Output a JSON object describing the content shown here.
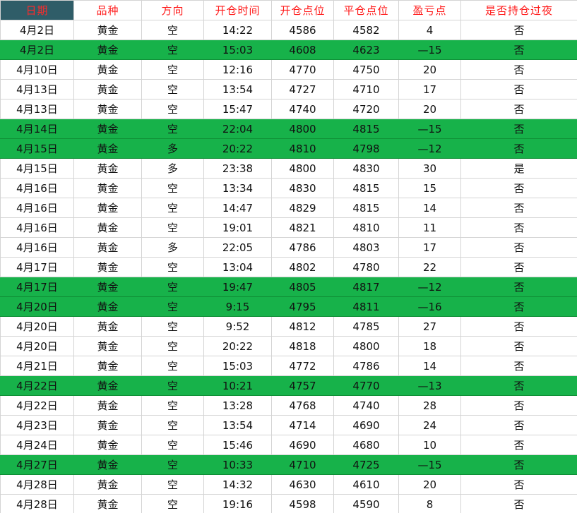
{
  "columns": [
    "日期",
    "品种",
    "方向",
    "开仓时间",
    "开仓点位",
    "平仓点位",
    "盈亏点",
    "是否持仓过夜"
  ],
  "rows": [
    {
      "date": "4月2日",
      "kind": "黄金",
      "dir": "空",
      "open_time": "14:22",
      "open": "4586",
      "close": "4582",
      "pnl": "4",
      "overnight": "否",
      "loss": false
    },
    {
      "date": "4月2日",
      "kind": "黄金",
      "dir": "空",
      "open_time": "15:03",
      "open": "4608",
      "close": "4623",
      "pnl": "—15",
      "overnight": "否",
      "loss": true
    },
    {
      "date": "4月10日",
      "kind": "黄金",
      "dir": "空",
      "open_time": "12:16",
      "open": "4770",
      "close": "4750",
      "pnl": "20",
      "overnight": "否",
      "loss": false
    },
    {
      "date": "4月13日",
      "kind": "黄金",
      "dir": "空",
      "open_time": "13:54",
      "open": "4727",
      "close": "4710",
      "pnl": "17",
      "overnight": "否",
      "loss": false
    },
    {
      "date": "4月13日",
      "kind": "黄金",
      "dir": "空",
      "open_time": "15:47",
      "open": "4740",
      "close": "4720",
      "pnl": "20",
      "overnight": "否",
      "loss": false
    },
    {
      "date": "4月14日",
      "kind": "黄金",
      "dir": "空",
      "open_time": "22:04",
      "open": "4800",
      "close": "4815",
      "pnl": "—15",
      "overnight": "否",
      "loss": true
    },
    {
      "date": "4月15日",
      "kind": "黄金",
      "dir": "多",
      "open_time": "20:22",
      "open": "4810",
      "close": "4798",
      "pnl": "—12",
      "overnight": "否",
      "loss": true
    },
    {
      "date": "4月15日",
      "kind": "黄金",
      "dir": "多",
      "open_time": "23:38",
      "open": "4800",
      "close": "4830",
      "pnl": "30",
      "overnight": "是",
      "loss": false
    },
    {
      "date": "4月16日",
      "kind": "黄金",
      "dir": "空",
      "open_time": "13:34",
      "open": "4830",
      "close": "4815",
      "pnl": "15",
      "overnight": "否",
      "loss": false
    },
    {
      "date": "4月16日",
      "kind": "黄金",
      "dir": "空",
      "open_time": "14:47",
      "open": "4829",
      "close": "4815",
      "pnl": "14",
      "overnight": "否",
      "loss": false
    },
    {
      "date": "4月16日",
      "kind": "黄金",
      "dir": "空",
      "open_time": "19:01",
      "open": "4821",
      "close": "4810",
      "pnl": "11",
      "overnight": "否",
      "loss": false
    },
    {
      "date": "4月16日",
      "kind": "黄金",
      "dir": "多",
      "open_time": "22:05",
      "open": "4786",
      "close": "4803",
      "pnl": "17",
      "overnight": "否",
      "loss": false
    },
    {
      "date": "4月17日",
      "kind": "黄金",
      "dir": "空",
      "open_time": "13:04",
      "open": "4802",
      "close": "4780",
      "pnl": "22",
      "overnight": "否",
      "loss": false
    },
    {
      "date": "4月17日",
      "kind": "黄金",
      "dir": "空",
      "open_time": "19:47",
      "open": "4805",
      "close": "4817",
      "pnl": "—12",
      "overnight": "否",
      "loss": true
    },
    {
      "date": "4月20日",
      "kind": "黄金",
      "dir": "空",
      "open_time": "9:15",
      "open": "4795",
      "close": "4811",
      "pnl": "—16",
      "overnight": "否",
      "loss": true
    },
    {
      "date": "4月20日",
      "kind": "黄金",
      "dir": "空",
      "open_time": "9:52",
      "open": "4812",
      "close": "4785",
      "pnl": "27",
      "overnight": "否",
      "loss": false
    },
    {
      "date": "4月20日",
      "kind": "黄金",
      "dir": "空",
      "open_time": "20:22",
      "open": "4818",
      "close": "4800",
      "pnl": "18",
      "overnight": "否",
      "loss": false
    },
    {
      "date": "4月21日",
      "kind": "黄金",
      "dir": "空",
      "open_time": "15:03",
      "open": "4772",
      "close": "4786",
      "pnl": "14",
      "overnight": "否",
      "loss": false
    },
    {
      "date": "4月22日",
      "kind": "黄金",
      "dir": "空",
      "open_time": "10:21",
      "open": "4757",
      "close": "4770",
      "pnl": "—13",
      "overnight": "否",
      "loss": true
    },
    {
      "date": "4月22日",
      "kind": "黄金",
      "dir": "空",
      "open_time": "13:28",
      "open": "4768",
      "close": "4740",
      "pnl": "28",
      "overnight": "否",
      "loss": false
    },
    {
      "date": "4月23日",
      "kind": "黄金",
      "dir": "空",
      "open_time": "13:54",
      "open": "4714",
      "close": "4690",
      "pnl": "24",
      "overnight": "否",
      "loss": false
    },
    {
      "date": "4月24日",
      "kind": "黄金",
      "dir": "空",
      "open_time": "15:46",
      "open": "4690",
      "close": "4680",
      "pnl": "10",
      "overnight": "否",
      "loss": false
    },
    {
      "date": "4月27日",
      "kind": "黄金",
      "dir": "空",
      "open_time": "10:33",
      "open": "4710",
      "close": "4725",
      "pnl": "—15",
      "overnight": "否",
      "loss": true
    },
    {
      "date": "4月28日",
      "kind": "黄金",
      "dir": "空",
      "open_time": "14:32",
      "open": "4630",
      "close": "4610",
      "pnl": "20",
      "overnight": "否",
      "loss": false
    },
    {
      "date": "4月28日",
      "kind": "黄金",
      "dir": "空",
      "open_time": "19:16",
      "open": "4598",
      "close": "4590",
      "pnl": "8",
      "overnight": "否",
      "loss": false
    }
  ],
  "colors": {
    "header_text": "#ff1a1a",
    "date_header_fill": "#2f5d68",
    "loss_row_fill": "#17b24a",
    "grid_line": "#d4d4d4"
  }
}
